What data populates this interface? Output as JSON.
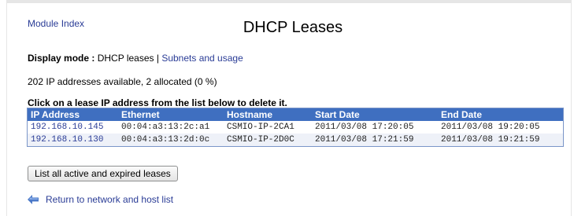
{
  "nav": {
    "module_index": "Module Index"
  },
  "page": {
    "title": "DHCP Leases"
  },
  "display_mode": {
    "label": "Display mode :",
    "current": "DHCP leases",
    "separator": "|",
    "alt_link": "Subnets and usage"
  },
  "availability": "202 IP addresses available, 2 allocated (0 %)",
  "instruction": "Click on a lease IP address from the list below to delete it.",
  "table": {
    "headers": [
      "IP Address",
      "Ethernet",
      "Hostname",
      "Start Date",
      "End Date"
    ],
    "rows": [
      [
        "192.168.10.145",
        "00:04:a3:13:2c:a1",
        "CSMIO-IP-2CA1",
        "2011/03/08 17:20:05",
        "2011/03/08 19:20:05"
      ],
      [
        "192.168.10.130",
        "00:04:a3:13:2d:0c",
        "CSMIO-IP-2D0C",
        "2011/03/08 17:21:59",
        "2011/03/08 19:21:59"
      ]
    ]
  },
  "buttons": {
    "list_all": "List all active and expired leases"
  },
  "footer": {
    "return_link": "Return to network and host list",
    "return_icon": "arrow-left-icon"
  },
  "colors": {
    "header_bg": "#3f6fc0",
    "link": "#2a3c96",
    "alt_row": "#eef1f8"
  }
}
